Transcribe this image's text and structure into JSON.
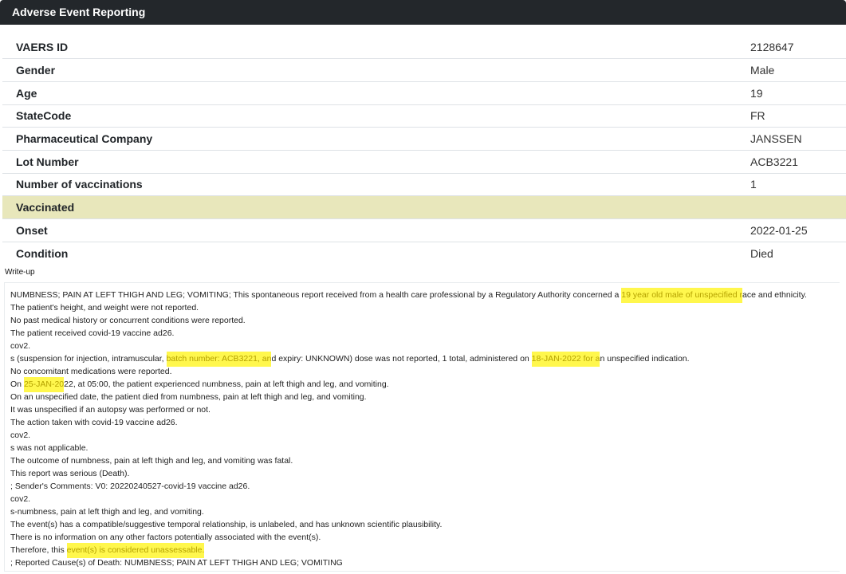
{
  "header": {
    "title": "Adverse Event Reporting"
  },
  "details": [
    {
      "key": "VAERS ID",
      "value": "2128647"
    },
    {
      "key": "Gender",
      "value": "Male"
    },
    {
      "key": "Age",
      "value": "19"
    },
    {
      "key": "StateCode",
      "value": "FR"
    },
    {
      "key": "Pharmaceutical Company",
      "value": "JANSSEN"
    },
    {
      "key": "Lot Number",
      "value": "ACB3221"
    },
    {
      "key": "Number of vaccinations",
      "value": "1"
    },
    {
      "key": "Vaccinated",
      "value": ""
    },
    {
      "key": "Onset",
      "value": "2022-01-25"
    },
    {
      "key": "Condition",
      "value": "Died"
    }
  ],
  "writeup": {
    "label": "Write-up",
    "highlight_color": "#fff74d",
    "lines": [
      [
        "NUMBNESS; PAIN AT LEFT THIGH AND LEG; VOMITING; This spontaneous report received from a health care professional by a Regulatory Authority concerned a ",
        {
          "hl": "19 year old male of unspecified r"
        },
        "ace and ethnicity."
      ],
      [
        "The patient's height, and weight were not reported."
      ],
      [
        "No past medical history or concurrent conditions were reported."
      ],
      [
        "The patient received covid-19 vaccine ad26."
      ],
      [
        "cov2."
      ],
      [
        "s (suspension for injection, intramuscular, ",
        {
          "hl": "batch number: ACB3221, an"
        },
        "d expiry: UNKNOWN) dose was not reported, 1 total, administered on ",
        {
          "hl": "18-JAN-2022 for a"
        },
        "n unspecified indication."
      ],
      [
        "No concomitant medications were reported."
      ],
      [
        "On ",
        {
          "hl": "25-JAN-20"
        },
        "22, at 05:00, the patient experienced numbness, pain at left thigh and leg, and vomiting."
      ],
      [
        "On an unspecified date, the patient died from numbness, pain at left thigh and leg, and vomiting."
      ],
      [
        "It was unspecified if an autopsy was performed or not."
      ],
      [
        "The action taken with covid-19 vaccine ad26."
      ],
      [
        "cov2."
      ],
      [
        "s was not applicable."
      ],
      [
        "The outcome of numbness, pain at left thigh and leg, and vomiting was fatal."
      ],
      [
        "This report was serious (Death)."
      ],
      [
        "; Sender's Comments: V0: 20220240527-covid-19 vaccine ad26."
      ],
      [
        "cov2."
      ],
      [
        "s-numbness, pain at left thigh and leg, and vomiting."
      ],
      [
        "The event(s) has a compatible/suggestive temporal relationship, is unlabeled, and has unknown scientific plausibility."
      ],
      [
        "There is no information on any other factors potentially associated with the event(s)."
      ],
      [
        "Therefore, this ",
        {
          "hl": "event(s) is considered unassessable."
        }
      ],
      [
        "; Reported Cause(s) of Death: NUMBNESS; PAIN AT LEFT THIGH AND LEG; VOMITING"
      ]
    ]
  }
}
